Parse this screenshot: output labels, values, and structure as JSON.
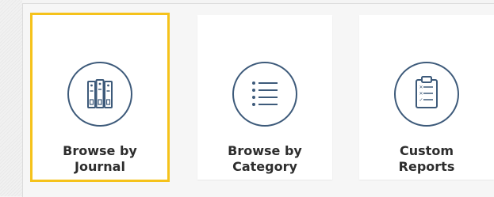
{
  "tiles": [
    {
      "id": "journal",
      "icon": "journal-binders-icon",
      "line1": "Browse by",
      "line2": "Journal",
      "selected": true
    },
    {
      "id": "category",
      "icon": "list-icon",
      "line1": "Browse by",
      "line2": "Category",
      "selected": false
    },
    {
      "id": "reports",
      "icon": "clipboard-checklist-icon",
      "line1": "Custom",
      "line2": "Reports",
      "selected": false
    }
  ],
  "colors": {
    "accent": "#f5c21b",
    "icon_stroke": "#3d5a7a",
    "label": "#2d2d2d"
  }
}
